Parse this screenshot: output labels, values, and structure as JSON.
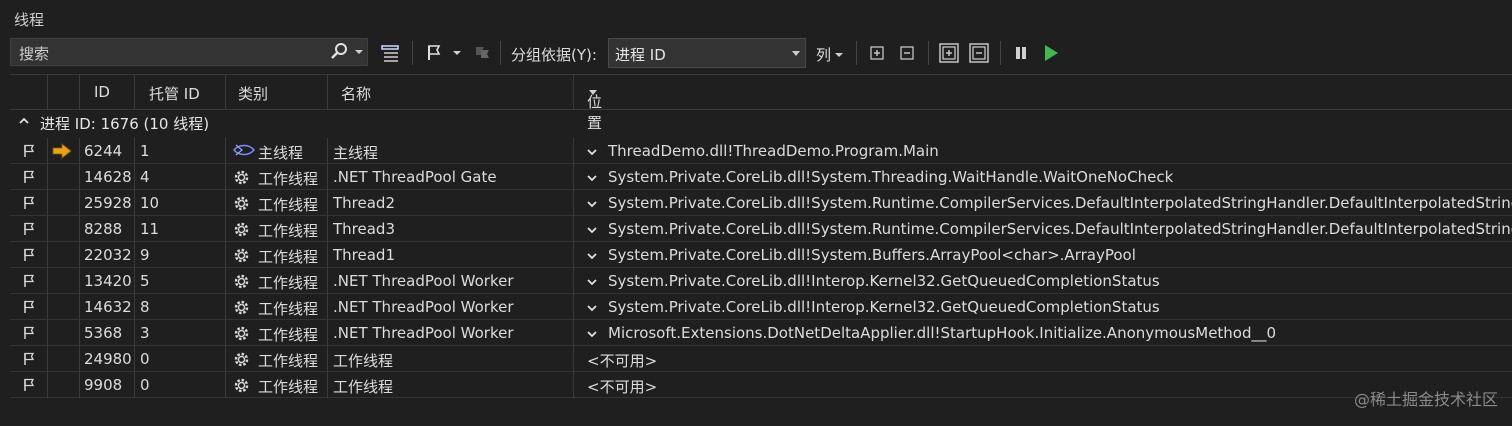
{
  "window": {
    "title": "线程"
  },
  "toolbar": {
    "search_placeholder": "搜索",
    "group_by_label": "分组依据(Y):",
    "group_by_value": "进程 ID",
    "columns_label": "列"
  },
  "columns": [
    "ID",
    "托管 ID",
    "类别",
    "名称",
    "位置"
  ],
  "group": {
    "caption": "进程 ID: 1676  (10 线程)"
  },
  "rows": [
    {
      "id": "6244",
      "managed_id": "1",
      "category": "主线程",
      "name": "主线程",
      "location": "ThreadDemo.dll!ThreadDemo.Program.Main",
      "current": true,
      "main": true,
      "expandable": true
    },
    {
      "id": "14628",
      "managed_id": "4",
      "category": "工作线程",
      "name": ".NET ThreadPool Gate",
      "location": "System.Private.CoreLib.dll!System.Threading.WaitHandle.WaitOneNoCheck",
      "expandable": true
    },
    {
      "id": "25928",
      "managed_id": "10",
      "category": "工作线程",
      "name": "Thread2",
      "location": "System.Private.CoreLib.dll!System.Runtime.CompilerServices.DefaultInterpolatedStringHandler.DefaultInterpolatedStringHandler",
      "expandable": true
    },
    {
      "id": "8288",
      "managed_id": "11",
      "category": "工作线程",
      "name": "Thread3",
      "location": "System.Private.CoreLib.dll!System.Runtime.CompilerServices.DefaultInterpolatedStringHandler.DefaultInterpolatedStringHandler",
      "expandable": true
    },
    {
      "id": "22032",
      "managed_id": "9",
      "category": "工作线程",
      "name": "Thread1",
      "location": "System.Private.CoreLib.dll!System.Buffers.ArrayPool<char>.ArrayPool",
      "expandable": true
    },
    {
      "id": "13420",
      "managed_id": "5",
      "category": "工作线程",
      "name": ".NET ThreadPool Worker",
      "location": "System.Private.CoreLib.dll!Interop.Kernel32.GetQueuedCompletionStatus",
      "expandable": true
    },
    {
      "id": "14632",
      "managed_id": "8",
      "category": "工作线程",
      "name": ".NET ThreadPool Worker",
      "location": "System.Private.CoreLib.dll!Interop.Kernel32.GetQueuedCompletionStatus",
      "expandable": true
    },
    {
      "id": "5368",
      "managed_id": "3",
      "category": "工作线程",
      "name": ".NET ThreadPool Worker",
      "location": "Microsoft.Extensions.DotNetDeltaApplier.dll!StartupHook.Initialize.AnonymousMethod__0",
      "expandable": true
    },
    {
      "id": "24980",
      "managed_id": "0",
      "category": "工作线程",
      "name": "工作线程",
      "location": "<不可用>",
      "expandable": false
    },
    {
      "id": "9908",
      "managed_id": "0",
      "category": "工作线程",
      "name": "工作线程",
      "location": "<不可用>",
      "expandable": false
    }
  ],
  "watermark": "@稀土掘金技术社区",
  "colors": {
    "background": "#1f1f1f",
    "accent_play": "#3fb950",
    "current_arrow": "#e8a317",
    "main_thread_icon": "#7a8cff"
  }
}
